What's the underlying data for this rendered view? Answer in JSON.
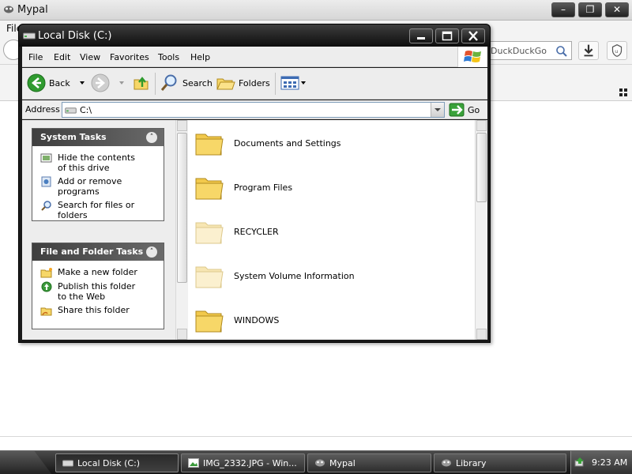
{
  "browser": {
    "title": "Mypal",
    "menu_file": "File",
    "urlbar_text": "DuckDuckGo"
  },
  "explorer": {
    "title": "Local Disk (C:)",
    "menu": [
      "File",
      "Edit",
      "View",
      "Favorites",
      "Tools",
      "Help"
    ],
    "toolbar": {
      "back": "Back",
      "search": "Search",
      "folders": "Folders"
    },
    "address": {
      "label": "Address",
      "value": "C:\\",
      "go": "Go"
    },
    "system_tasks": {
      "title": "System Tasks",
      "items": [
        {
          "label": "Hide the contents of this drive",
          "icon": "hide-contents-icon"
        },
        {
          "label": "Add or remove programs",
          "icon": "add-remove-programs-icon"
        },
        {
          "label": "Search for files or folders",
          "icon": "search-icon"
        }
      ]
    },
    "file_folder_tasks": {
      "title": "File and Folder Tasks",
      "items": [
        {
          "label": "Make a new folder",
          "icon": "new-folder-icon"
        },
        {
          "label": "Publish this folder to the Web",
          "icon": "publish-web-icon"
        },
        {
          "label": "Share this folder",
          "icon": "share-folder-icon"
        }
      ]
    },
    "files": [
      {
        "name": "Documents and Settings",
        "hidden": false
      },
      {
        "name": "Program Files",
        "hidden": false
      },
      {
        "name": "RECYCLER",
        "hidden": true
      },
      {
        "name": "System Volume Information",
        "hidden": true
      },
      {
        "name": "WINDOWS",
        "hidden": false
      }
    ]
  },
  "taskbar": {
    "buttons": [
      {
        "label": "Local Disk (C:)",
        "icon": "drive-icon",
        "active": true
      },
      {
        "label": "IMG_2332.JPG - Win...",
        "icon": "image-viewer-icon",
        "active": false
      },
      {
        "label": "Mypal",
        "icon": "mypal-icon",
        "active": false
      },
      {
        "label": "Library",
        "icon": "library-icon",
        "active": false
      }
    ],
    "clock": "9:23 AM"
  },
  "colors": {
    "folder_yellow": "#f7d768",
    "folder_faded": "#fbf0cf",
    "go_green": "#3aa23a",
    "back_green": "#2f9b2f"
  }
}
